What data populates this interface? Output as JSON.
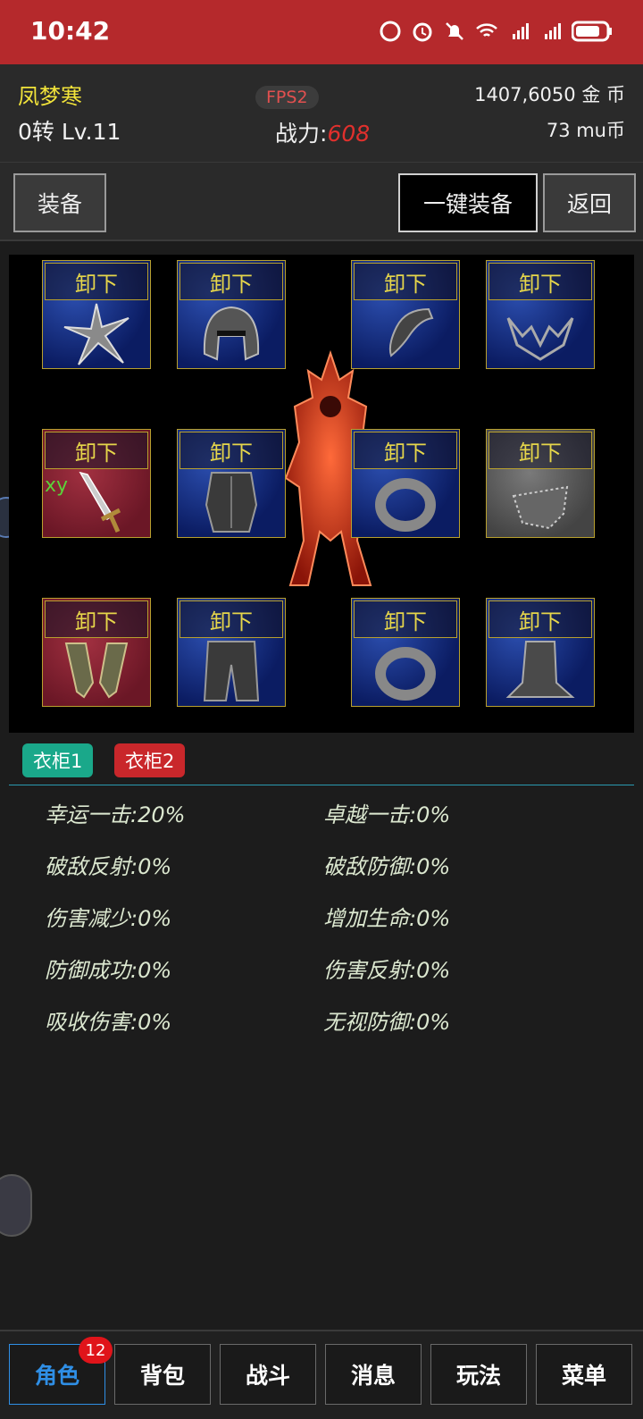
{
  "status": {
    "time": "10:42"
  },
  "header": {
    "player_name": "凤梦寒",
    "level": "0转 Lv.11",
    "fps": "FPS2",
    "power_label": "战力:",
    "power_value": "608",
    "gold": "1407,6050 金 币",
    "mu": "73 mu币"
  },
  "toolbar": {
    "equip_label": "装备",
    "one_click_label": "一键装备",
    "back_label": "返回"
  },
  "slots": {
    "unequip_label": "卸下",
    "xy_tag": "xy",
    "items": [
      {
        "name": "weapon-star-icon",
        "tint": "blue"
      },
      {
        "name": "helmet-icon",
        "tint": "blue"
      },
      {
        "name": "pendant-icon",
        "tint": "blue"
      },
      {
        "name": "wings-icon",
        "tint": "blue"
      },
      {
        "name": "sword-icon",
        "tint": "red"
      },
      {
        "name": "armor-icon",
        "tint": "blue"
      },
      {
        "name": "ring-icon",
        "tint": "blue"
      },
      {
        "name": "gloves-icon",
        "tint": "grey"
      },
      {
        "name": "gauntlets-icon",
        "tint": "red"
      },
      {
        "name": "pants-icon",
        "tint": "blue"
      },
      {
        "name": "ring-icon",
        "tint": "blue"
      },
      {
        "name": "boots-icon",
        "tint": "blue"
      }
    ]
  },
  "wardrobe": {
    "tab1": "衣柜1",
    "tab2": "衣柜2"
  },
  "stats": [
    {
      "label": "幸运一击:",
      "value": "20%"
    },
    {
      "label": "卓越一击:",
      "value": "0%"
    },
    {
      "label": "破敌反射:",
      "value": "0%"
    },
    {
      "label": "破敌防御:",
      "value": "0%"
    },
    {
      "label": "伤害减少:",
      "value": "0%"
    },
    {
      "label": "增加生命:",
      "value": "0%"
    },
    {
      "label": "防御成功:",
      "value": "0%"
    },
    {
      "label": "伤害反射:",
      "value": "0%"
    },
    {
      "label": "吸收伤害:",
      "value": "0%"
    },
    {
      "label": "无视防御:",
      "value": "0%"
    }
  ],
  "nav": {
    "items": [
      "角色",
      "背包",
      "战斗",
      "消息",
      "玩法",
      "菜单"
    ],
    "badge": "12"
  },
  "colors": {
    "statusbar": "#b5292c",
    "name": "#f2e43a",
    "power": "#e0302d",
    "active_nav": "#2f8fe6",
    "wardrobe1": "#1aa88a",
    "wardrobe2": "#c9272b"
  }
}
